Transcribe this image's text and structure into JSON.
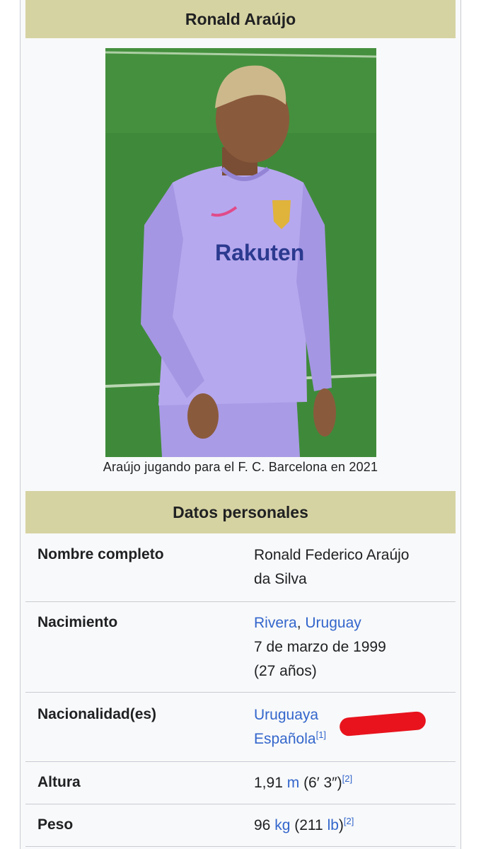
{
  "infobox": {
    "title": "Ronald Araújo",
    "caption": "Araújo jugando para el F. C. Barcelona en 2021",
    "image": {
      "alt": "Player in lavender FC Barcelona kit on green pitch",
      "sponsor_text": "Rakuten",
      "colors": {
        "pitch": "#3f8a3a",
        "kit": "#b6a8ee",
        "skin": "#8a5a3c"
      }
    },
    "section_title": "Datos personales",
    "rows": [
      {
        "label": "Nombre completo",
        "value_line1": "Ronald Federico Araújo",
        "value_line2": "da Silva"
      },
      {
        "label": "Nacimiento",
        "birth_city": "Rivera",
        "birth_sep": ",",
        "birth_country": "Uruguay",
        "birth_date": "7 de marzo de 1999",
        "age": "(27 años)"
      },
      {
        "label": "Nacionalidad(es)",
        "nat1": "Uruguaya",
        "nat2": "Española",
        "nat2_ref": "[1]"
      },
      {
        "label": "Altura",
        "value_num": "1,91",
        "unit": "m",
        "imperial": "(6′ 3″)",
        "ref": "[2]"
      },
      {
        "label": "Peso",
        "value_num": "96",
        "unit": "kg",
        "imperial_open": "(211",
        "imperial_unit": "lb",
        "imperial_close": ")",
        "ref": "[2]"
      }
    ]
  },
  "colors": {
    "header_bg": "#d6d3a3",
    "link": "#3366cc",
    "redaction": "#e8131d"
  }
}
